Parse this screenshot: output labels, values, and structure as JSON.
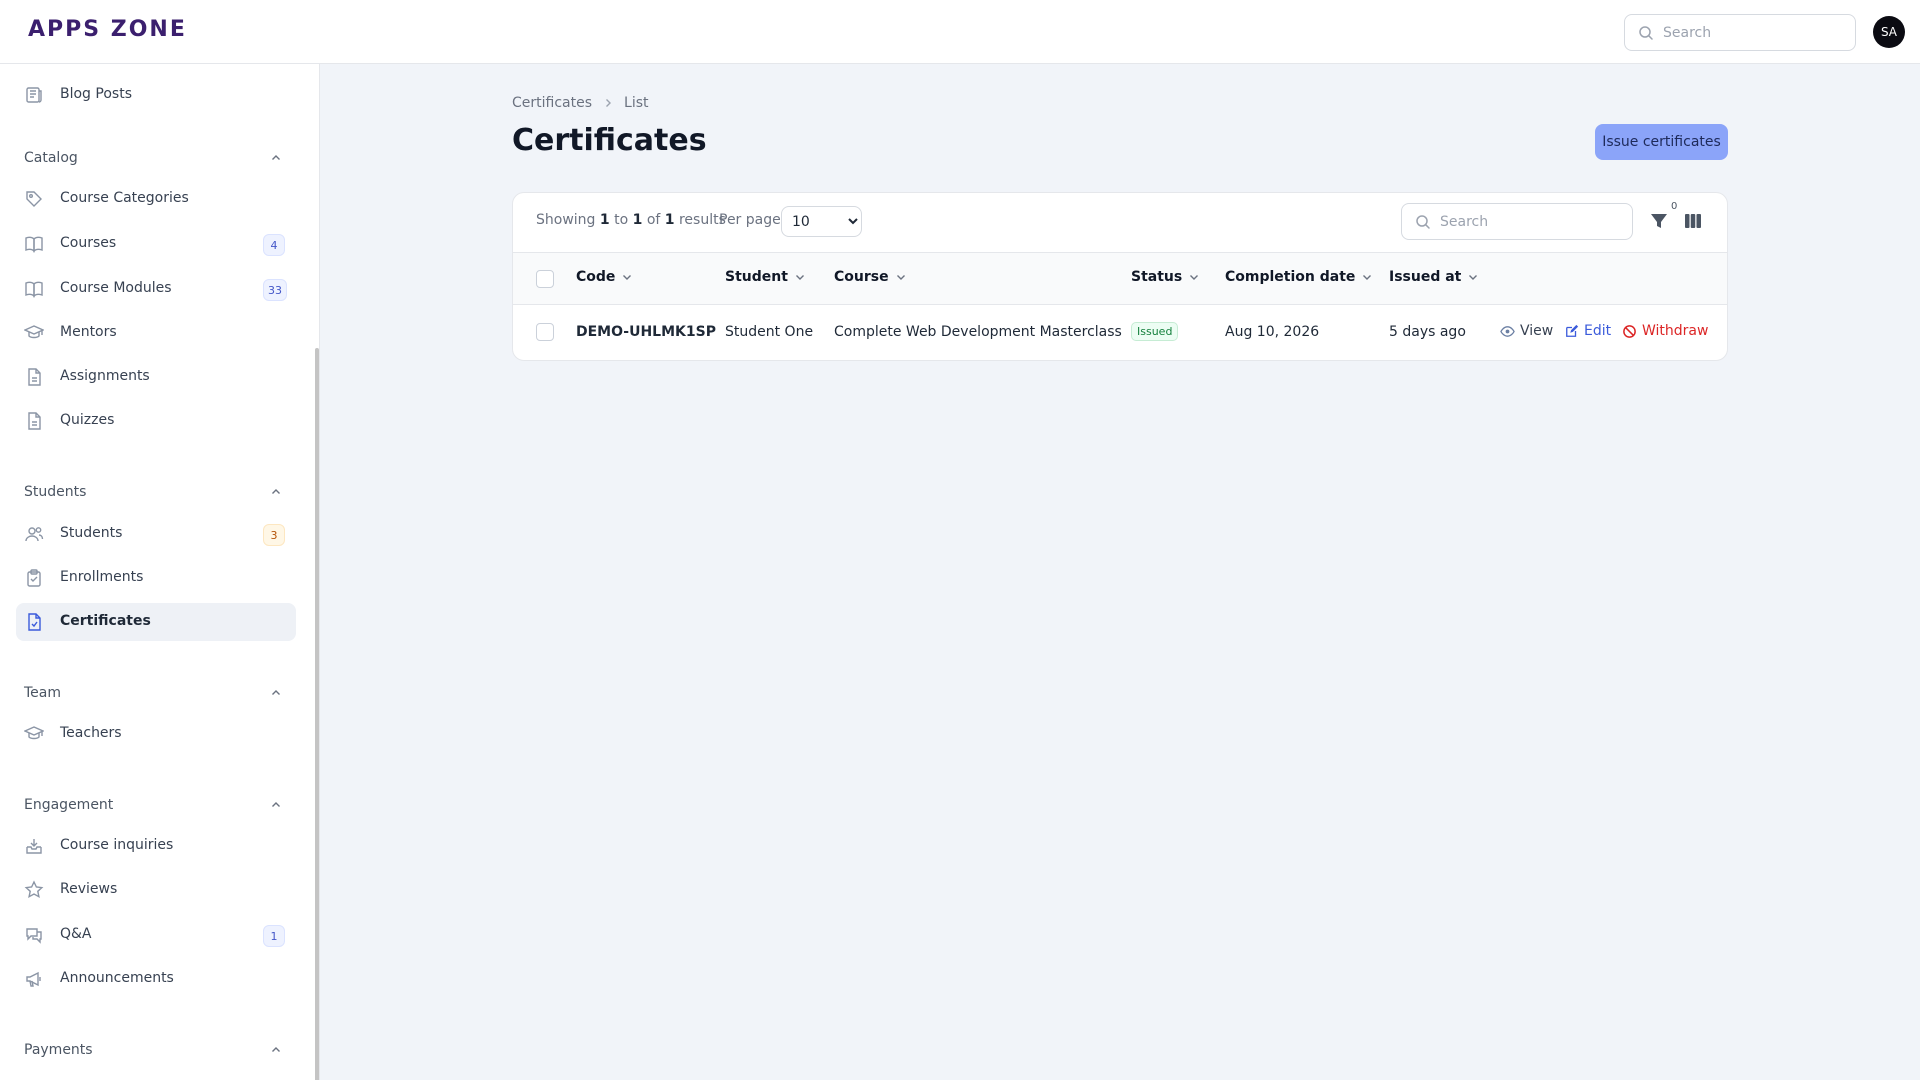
{
  "app": {
    "logo": "APPS ZONE",
    "avatar_initials": "SA"
  },
  "header": {
    "search_placeholder": "Search"
  },
  "sidebar": {
    "top_items": [
      {
        "label": "Blog Posts",
        "icon": "blog-posts-icon"
      }
    ],
    "groups": [
      {
        "label": "Catalog",
        "items": [
          {
            "label": "Course Categories",
            "icon": "tag-icon"
          },
          {
            "label": "Courses",
            "icon": "book-icon",
            "badge": "4"
          },
          {
            "label": "Course Modules",
            "icon": "book-icon",
            "badge": "33"
          },
          {
            "label": "Mentors",
            "icon": "graduation-cap-icon"
          },
          {
            "label": "Assignments",
            "icon": "document-icon"
          },
          {
            "label": "Quizzes",
            "icon": "document-icon"
          }
        ]
      },
      {
        "label": "Students",
        "items": [
          {
            "label": "Students",
            "icon": "users-icon",
            "badge": "3"
          },
          {
            "label": "Enrollments",
            "icon": "clipboard-icon"
          },
          {
            "label": "Certificates",
            "icon": "document-check-icon",
            "active": true
          }
        ]
      },
      {
        "label": "Team",
        "items": [
          {
            "label": "Teachers",
            "icon": "graduation-cap-icon"
          }
        ]
      },
      {
        "label": "Engagement",
        "items": [
          {
            "label": "Course inquiries",
            "icon": "inbox-icon"
          },
          {
            "label": "Reviews",
            "icon": "star-icon"
          },
          {
            "label": "Q&A",
            "icon": "chat-icon",
            "badge": "1"
          },
          {
            "label": "Announcements",
            "icon": "megaphone-icon"
          }
        ]
      },
      {
        "label": "Payments",
        "items": []
      }
    ]
  },
  "breadcrumb": {
    "items": [
      "Certificates",
      "List"
    ]
  },
  "page": {
    "title": "Certificates",
    "primary_action": "Issue certificates"
  },
  "table": {
    "showing": {
      "prefix": "Showing",
      "from": "1",
      "to_word": "to",
      "to": "1",
      "of_word": "of",
      "total": "1",
      "suffix": "results"
    },
    "per_page_label": "Per page",
    "per_page_value": "10",
    "per_page_options": [
      "10"
    ],
    "search_placeholder": "Search",
    "filter_count": "0",
    "columns": [
      "Code",
      "Student",
      "Course",
      "Status",
      "Completion date",
      "Issued at"
    ],
    "rows": [
      {
        "code": "DEMO-UHLMK1SP",
        "student": "Student One",
        "course": "Complete Web Development Masterclass",
        "status": "Issued",
        "completion_date": "Aug 10, 2026",
        "issued_at": "5 days ago"
      }
    ],
    "row_actions": {
      "view": "View",
      "edit": "Edit",
      "withdraw": "Withdraw"
    }
  },
  "colors": {
    "accent": "#3b5bdb",
    "primary_button": "#8ba4f9",
    "danger": "#dc2626",
    "success": "#15803d",
    "badge_amber": "#b45309"
  }
}
